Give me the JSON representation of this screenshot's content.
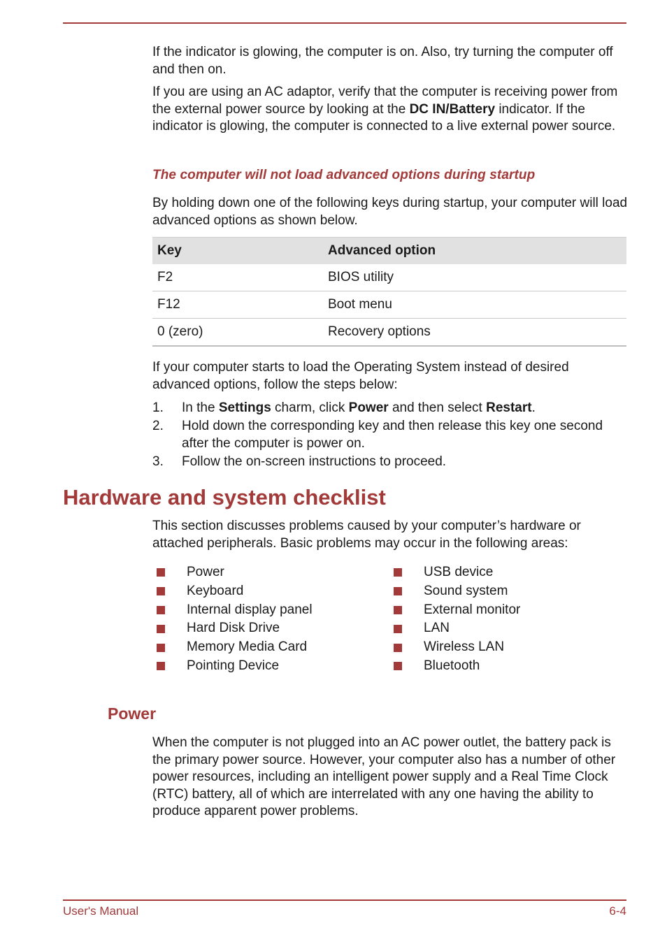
{
  "header": {},
  "intro": {
    "p1": "If the indicator is glowing, the computer is on. Also, try turning the computer off and then on.",
    "p2_a": "If you are using an AC adaptor, verify that the computer is receiving power from the external power source by looking at the ",
    "p2_bold": "DC IN/Battery",
    "p2_b": " indicator. If the indicator is glowing, the computer is connected to a live external power source."
  },
  "advanced": {
    "heading": "The computer will not load advanced options during startup",
    "intro": "By holding down one of the following keys during startup, your computer will load advanced options as shown below.",
    "table": {
      "headers": [
        "Key",
        "Advanced option"
      ],
      "rows": [
        [
          "F2",
          "BIOS utility"
        ],
        [
          "F12",
          "Boot menu"
        ],
        [
          "0 (zero)",
          "Recovery options"
        ]
      ]
    },
    "after": "If your computer starts to load the Operating System instead of desired advanced options, follow the steps below:",
    "steps": [
      {
        "num": "1.",
        "parts": [
          "In the ",
          "Settings",
          " charm, click ",
          "Power",
          " and then select ",
          "Restart",
          "."
        ]
      },
      {
        "num": "2.",
        "text": "Hold down the corresponding key and then release this key one second after the computer is power on."
      },
      {
        "num": "3.",
        "text": "Follow the on-screen instructions to proceed."
      }
    ]
  },
  "checklist": {
    "heading": "Hardware and system checklist",
    "intro": "This section discusses problems caused by your computer’s hardware or attached peripherals. Basic problems may occur in the following areas:",
    "left": [
      "Power",
      "Keyboard",
      "Internal display panel",
      "Hard Disk Drive",
      "Memory Media Card",
      "Pointing Device"
    ],
    "right": [
      "USB device",
      "Sound system",
      "External monitor",
      "LAN",
      "Wireless LAN",
      "Bluetooth"
    ]
  },
  "power": {
    "heading": "Power",
    "text": "When the computer is not plugged into an AC power outlet, the battery pack is the primary power source. However, your computer also has a number of other power resources, including an intelligent power supply and a Real Time Clock (RTC) battery, all of which are interrelated with any one having the ability to produce apparent power problems."
  },
  "footer": {
    "title": "User's Manual",
    "page": "6-4"
  },
  "colors": {
    "accent": "#a33a3a",
    "table_header_bg": "#e1e1e1"
  }
}
